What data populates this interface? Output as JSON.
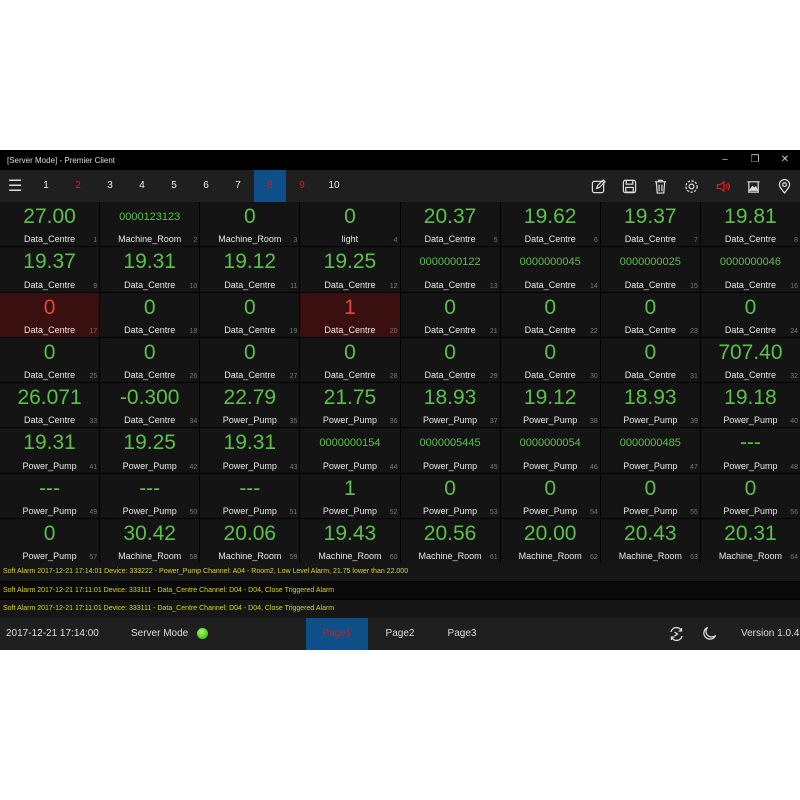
{
  "window": {
    "title": "[Server Mode] - Premier Client",
    "minimize": "–",
    "restore": "❐",
    "close": "✕"
  },
  "toolbar": {
    "pages": [
      {
        "label": "1",
        "state": "normal"
      },
      {
        "label": "2",
        "state": "red"
      },
      {
        "label": "3",
        "state": "normal"
      },
      {
        "label": "4",
        "state": "normal"
      },
      {
        "label": "5",
        "state": "normal"
      },
      {
        "label": "6",
        "state": "normal"
      },
      {
        "label": "7",
        "state": "normal"
      },
      {
        "label": "8",
        "state": "selected"
      },
      {
        "label": "9",
        "state": "red"
      },
      {
        "label": "10",
        "state": "normal"
      }
    ],
    "tools": [
      "edit-icon",
      "save-icon",
      "delete-icon",
      "settings-icon",
      "speaker-icon",
      "picture-icon",
      "location-icon"
    ],
    "speaker_color": "#d02020"
  },
  "cells": [
    {
      "v": "27.00",
      "l": "Data_Centre"
    },
    {
      "v": "0000123123",
      "l": "Machine_Room",
      "s": 1
    },
    {
      "v": "0",
      "l": "Machine_Room"
    },
    {
      "v": "0",
      "l": "light"
    },
    {
      "v": "20.37",
      "l": "Data_Centre"
    },
    {
      "v": "19.62",
      "l": "Data_Centre"
    },
    {
      "v": "19.37",
      "l": "Data_Centre"
    },
    {
      "v": "19.81",
      "l": "Data_Centre"
    },
    {
      "v": "19.37",
      "l": "Data_Centre"
    },
    {
      "v": "19.31",
      "l": "Data_Centre"
    },
    {
      "v": "19.12",
      "l": "Data_Centre"
    },
    {
      "v": "19.25",
      "l": "Data_Centre"
    },
    {
      "v": "0000000122",
      "l": "Data_Centre",
      "s": 1
    },
    {
      "v": "0000000045",
      "l": "Data_Centre",
      "s": 1
    },
    {
      "v": "0000000025",
      "l": "Data_Centre",
      "s": 1
    },
    {
      "v": "0000000046",
      "l": "Data_Centre",
      "s": 1
    },
    {
      "v": "0",
      "l": "Data_Centre",
      "a": 1
    },
    {
      "v": "0",
      "l": "Data_Centre"
    },
    {
      "v": "0",
      "l": "Data_Centre"
    },
    {
      "v": "1",
      "l": "Data_Centre",
      "a": 1
    },
    {
      "v": "0",
      "l": "Data_Centre"
    },
    {
      "v": "0",
      "l": "Data_Centre"
    },
    {
      "v": "0",
      "l": "Data_Centre"
    },
    {
      "v": "0",
      "l": "Data_Centre"
    },
    {
      "v": "0",
      "l": "Data_Centre"
    },
    {
      "v": "0",
      "l": "Data_Centre"
    },
    {
      "v": "0",
      "l": "Data_Centre"
    },
    {
      "v": "0",
      "l": "Data_Centre"
    },
    {
      "v": "0",
      "l": "Data_Centre"
    },
    {
      "v": "0",
      "l": "Data_Centre"
    },
    {
      "v": "0",
      "l": "Data_Centre"
    },
    {
      "v": "707.40",
      "l": "Data_Centre"
    },
    {
      "v": "26.071",
      "l": "Data_Centre"
    },
    {
      "v": "-0.300",
      "l": "Data_Centre"
    },
    {
      "v": "22.79",
      "l": "Power_Pump"
    },
    {
      "v": "21.75",
      "l": "Power_Pump"
    },
    {
      "v": "18.93",
      "l": "Power_Pump"
    },
    {
      "v": "19.12",
      "l": "Power_Pump"
    },
    {
      "v": "18.93",
      "l": "Power_Pump"
    },
    {
      "v": "19.18",
      "l": "Power_Pump"
    },
    {
      "v": "19.31",
      "l": "Power_Pump"
    },
    {
      "v": "19.25",
      "l": "Power_Pump"
    },
    {
      "v": "19.31",
      "l": "Power_Pump"
    },
    {
      "v": "0000000154",
      "l": "Power_Pump",
      "s": 1
    },
    {
      "v": "0000005445",
      "l": "Power_Pump",
      "s": 1
    },
    {
      "v": "0000000054",
      "l": "Power_Pump",
      "s": 1
    },
    {
      "v": "0000000485",
      "l": "Power_Pump",
      "s": 1
    },
    {
      "v": "---",
      "l": "Power_Pump"
    },
    {
      "v": "---",
      "l": "Power_Pump"
    },
    {
      "v": "---",
      "l": "Power_Pump"
    },
    {
      "v": "---",
      "l": "Power_Pump"
    },
    {
      "v": "1",
      "l": "Power_Pump"
    },
    {
      "v": "0",
      "l": "Power_Pump"
    },
    {
      "v": "0",
      "l": "Power_Pump"
    },
    {
      "v": "0",
      "l": "Power_Pump"
    },
    {
      "v": "0",
      "l": "Power_Pump"
    },
    {
      "v": "0",
      "l": "Power_Pump"
    },
    {
      "v": "30.42",
      "l": "Machine_Room"
    },
    {
      "v": "20.06",
      "l": "Machine_Room"
    },
    {
      "v": "19.43",
      "l": "Machine_Room"
    },
    {
      "v": "20.56",
      "l": "Machine_Room"
    },
    {
      "v": "20.00",
      "l": "Machine_Room"
    },
    {
      "v": "20.43",
      "l": "Machine_Room"
    },
    {
      "v": "20.31",
      "l": "Machine_Room"
    }
  ],
  "alarms": [
    "Soft Alarm 2017-12-21 17:14:01 Device: 333222 - Power_Pump Channel: A04 - Room2, Low Level Alarm, 21.75 lower than 22.000",
    "Soft Alarm 2017-12-21 17:11:01 Device: 333111 - Data_Centre Channel: D04 - D04, Close Triggered Alarm",
    "Soft Alarm 2017-12-21 17:11:01 Device: 333111 - Data_Centre Channel: D04 - D04, Close Triggered Alarm"
  ],
  "status": {
    "datetime": "2017-12-21 17:14:00",
    "mode": "Server Mode",
    "tabs": [
      "Page1",
      "Page2",
      "Page3"
    ],
    "selected_tab": "Page1",
    "version": "Version 1.0.4"
  }
}
